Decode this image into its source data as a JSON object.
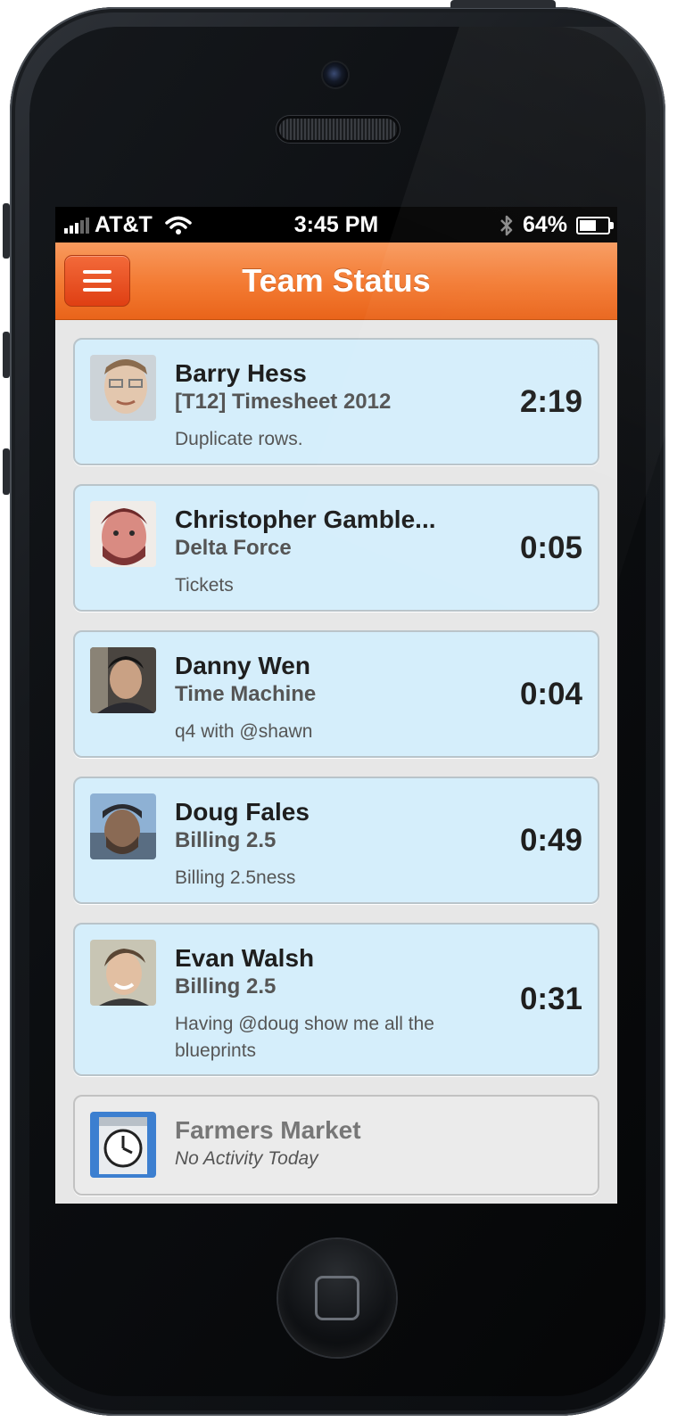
{
  "status_bar": {
    "carrier": "AT&T",
    "time": "3:45 PM",
    "battery": "64%",
    "battery_level": 0.64
  },
  "navbar": {
    "title": "Team Status",
    "menu_icon": "hamburger-icon"
  },
  "entries": [
    {
      "name": "Barry Hess",
      "project": "[T12] Timesheet 2012",
      "note": "Duplicate rows.",
      "time": "2:19",
      "avatar_color": "#d9c3ad"
    },
    {
      "name": "Christopher Gamble...",
      "project": "Delta Force",
      "note": "Tickets",
      "time": "0:05",
      "avatar_color": "#8a3a46"
    },
    {
      "name": "Danny Wen",
      "project": "Time Machine",
      "note": "q4 with @shawn",
      "time": "0:04",
      "avatar_color": "#3d3a36"
    },
    {
      "name": "Doug Fales",
      "project": "Billing 2.5",
      "note": "Billing 2.5ness",
      "time": "0:49",
      "avatar_color": "#6c88a8"
    },
    {
      "name": "Evan Walsh",
      "project": "Billing 2.5",
      "note": "Having @doug show me all the blueprints",
      "time": "0:31",
      "avatar_color": "#b9b49e"
    }
  ],
  "inactive_entry": {
    "name": "Farmers Market",
    "status": "No Activity Today",
    "avatar_icon": "clock-tower-icon",
    "avatar_color": "#3c7fd0"
  }
}
